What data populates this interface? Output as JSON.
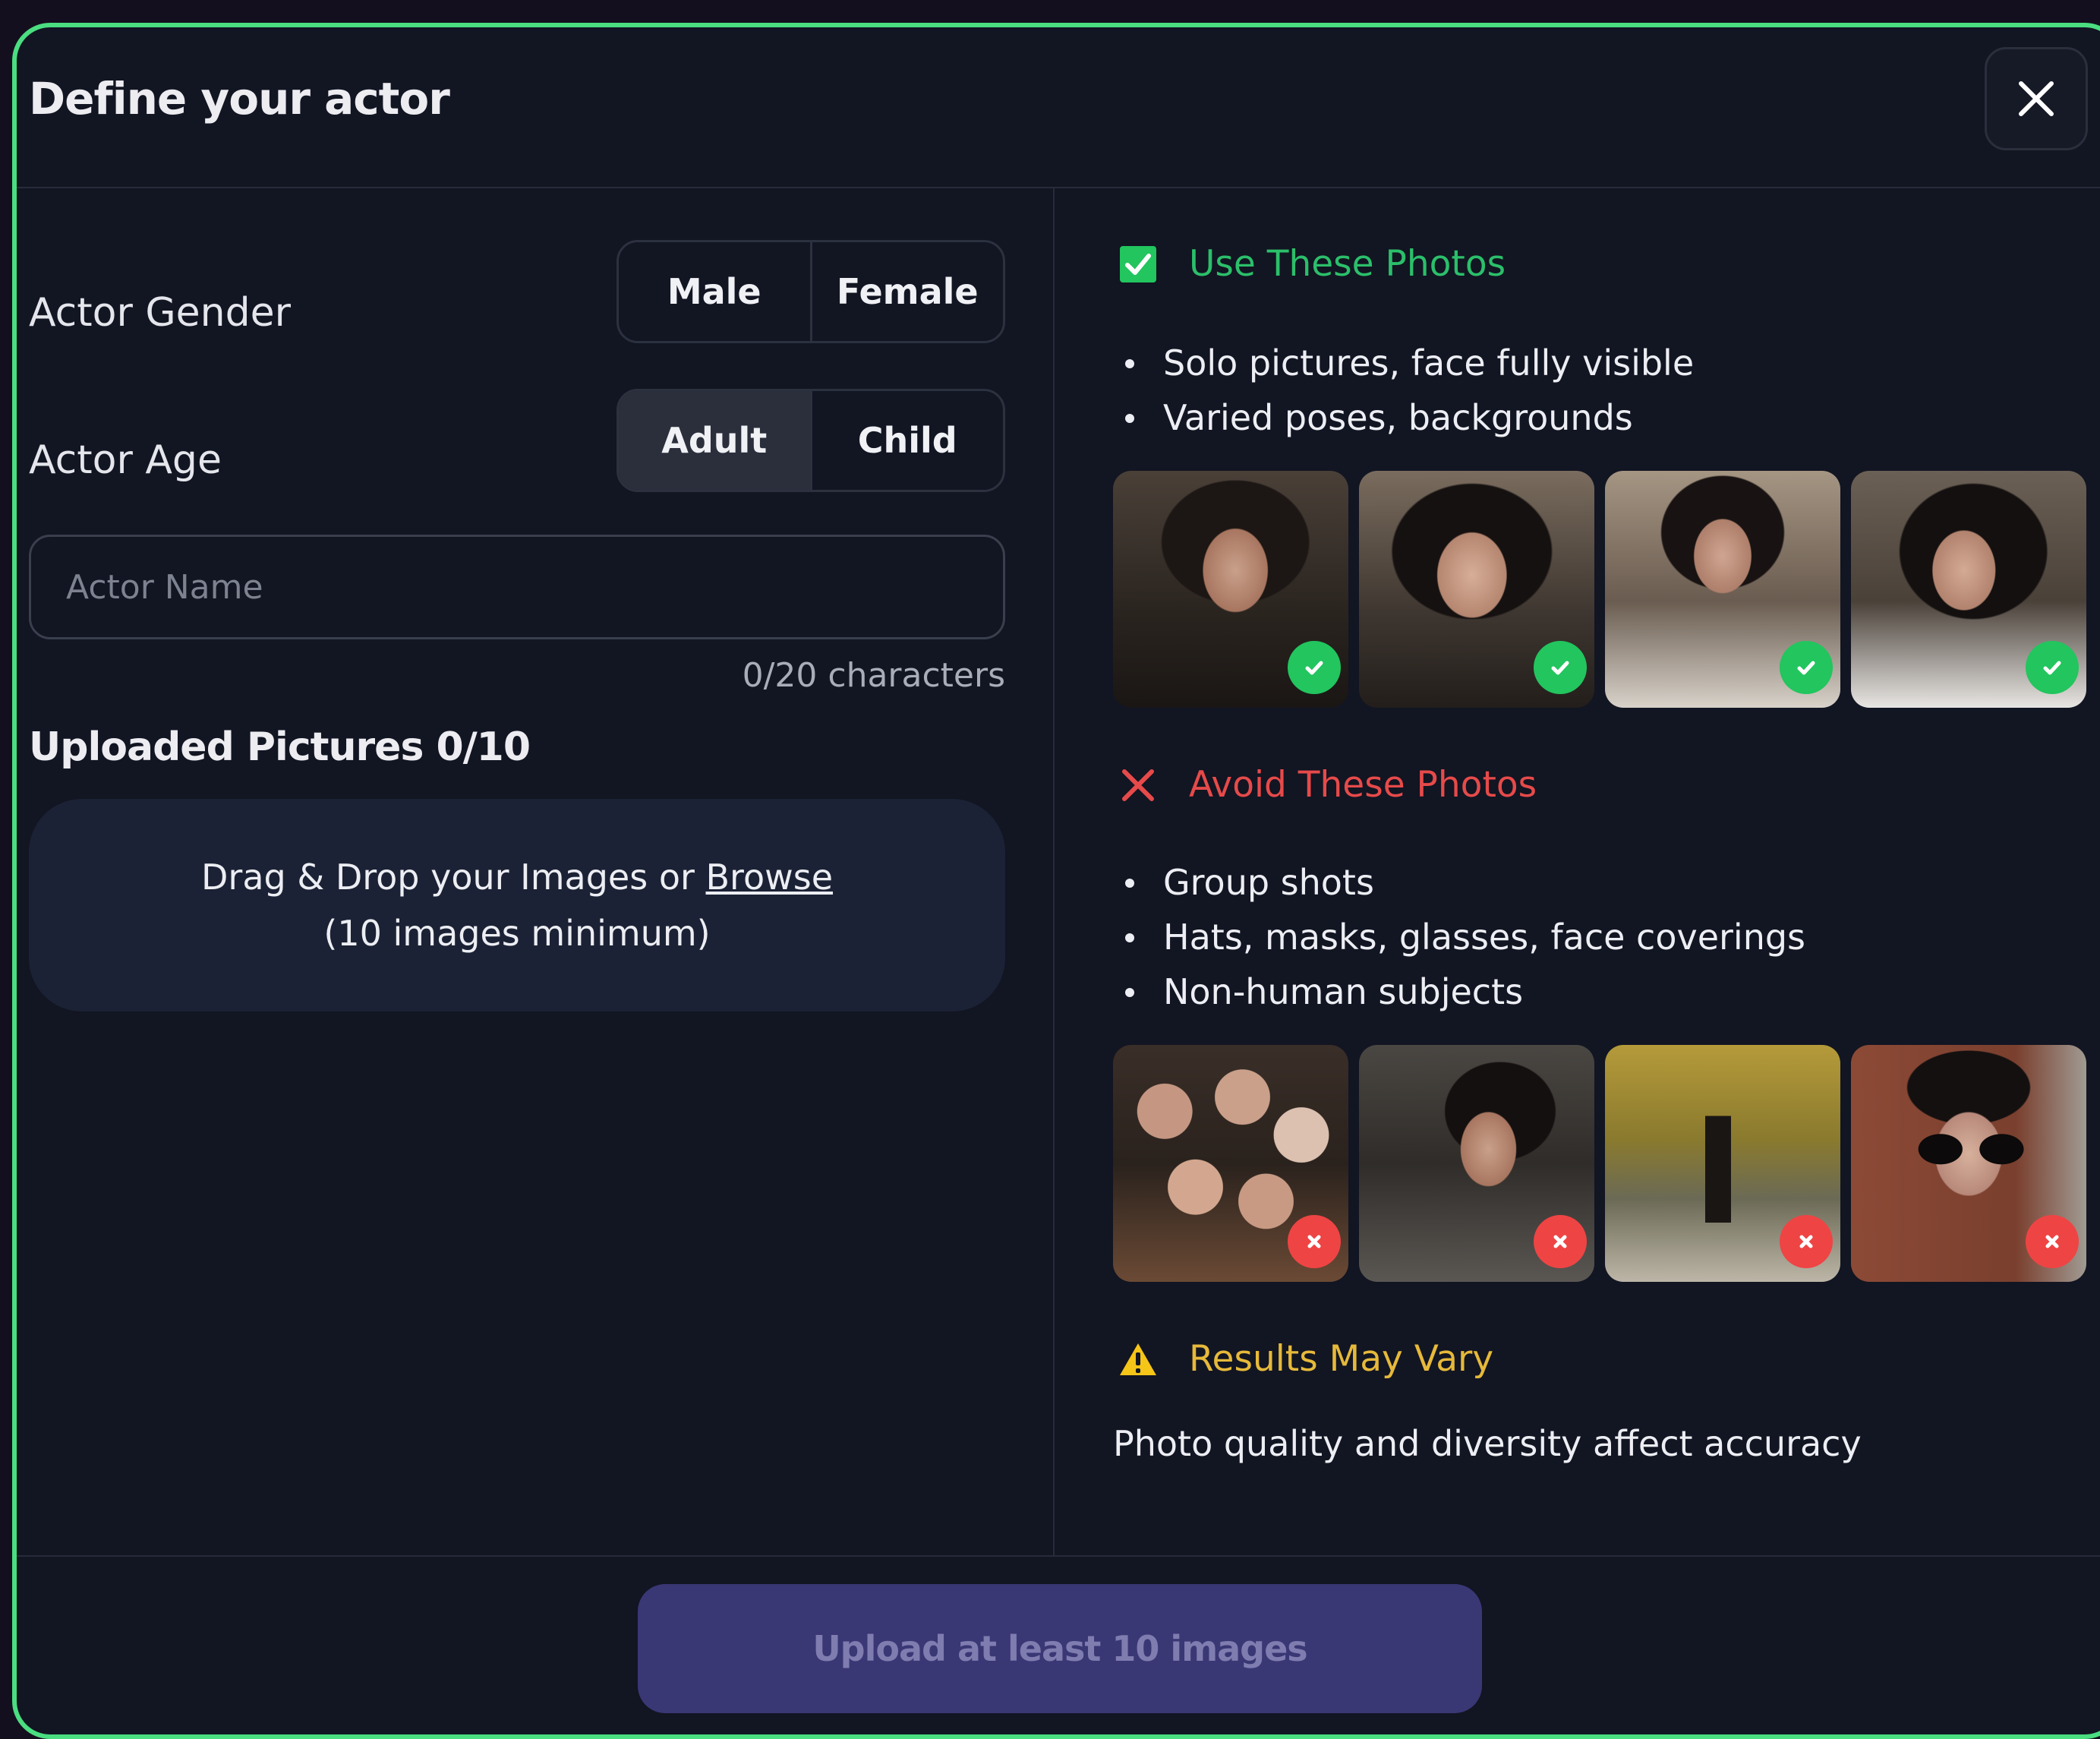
{
  "dialog": {
    "title": "Define your actor"
  },
  "form": {
    "gender": {
      "label": "Actor Gender",
      "options": [
        "Male",
        "Female"
      ]
    },
    "age": {
      "label": "Actor Age",
      "options": [
        "Adult",
        "Child"
      ],
      "selected": "Adult"
    },
    "name": {
      "placeholder": "Actor Name",
      "value": "",
      "counter": "0/20 characters"
    },
    "uploaded_title": "Uploaded Pictures 0/10",
    "dropzone": {
      "prefix": "Drag & Drop your Images or ",
      "browse": "Browse",
      "hint": "(10 images minimum)"
    }
  },
  "guide": {
    "use": {
      "title": "Use These Photos",
      "color": "#2bbf6a",
      "bullets": [
        "Solo pictures, face fully visible",
        "Varied poses, backgrounds"
      ]
    },
    "avoid": {
      "title": "Avoid These Photos",
      "color": "#e64a4a",
      "bullets": [
        "Group shots",
        "Hats, masks, glasses, face coverings",
        "Non-human subjects"
      ]
    },
    "warning": {
      "title": "Results May Vary",
      "color": "#e6b93a",
      "text": "Photo quality and diversity affect accuracy"
    }
  },
  "footer": {
    "submit_label": "Upload at least 10 images"
  }
}
